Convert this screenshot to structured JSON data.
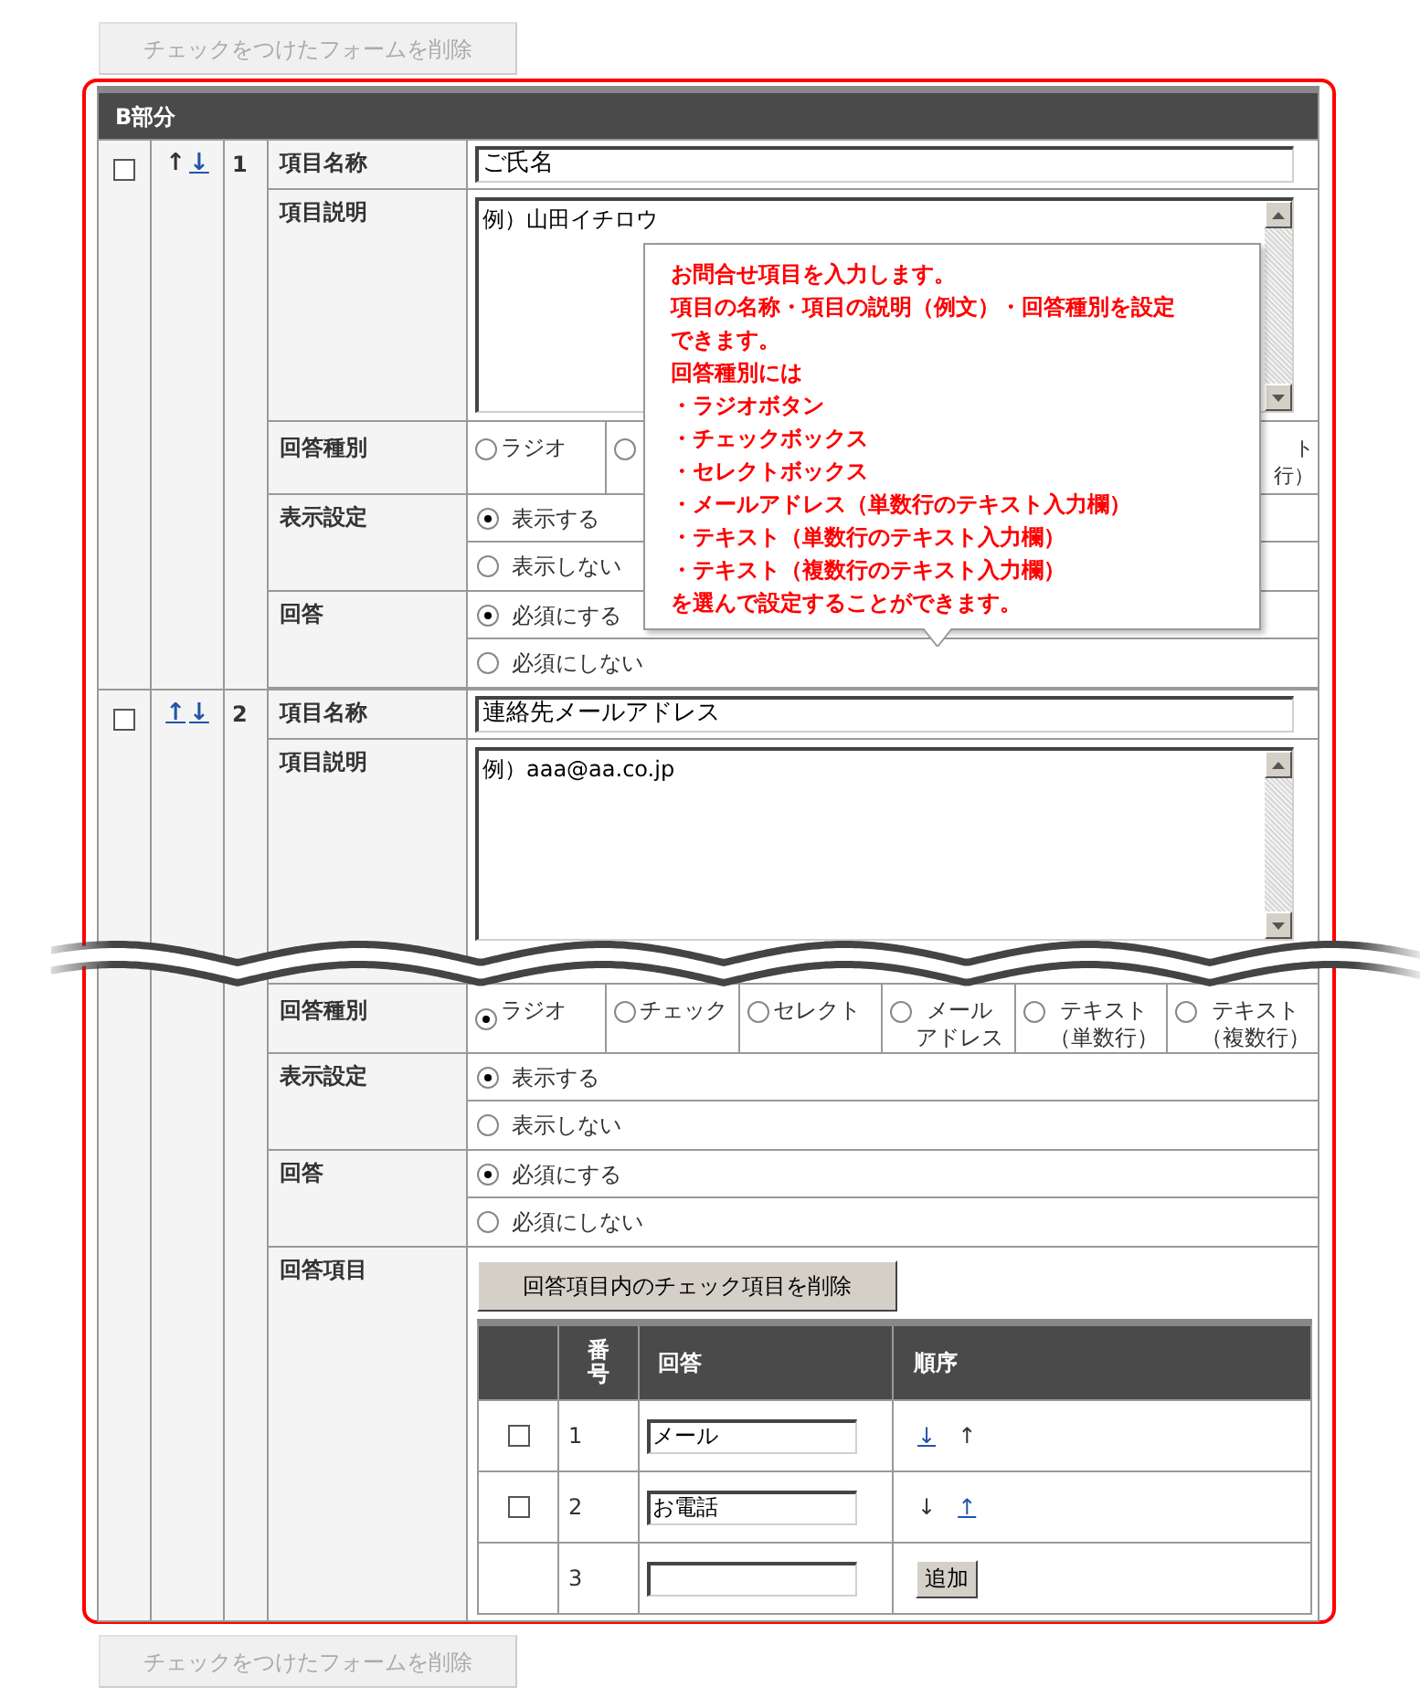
{
  "top_button": {
    "label": "チェックをつけたフォームを削除",
    "disabled": true
  },
  "section": {
    "title": "B部分",
    "items": [
      {
        "checked": false,
        "move_up": {
          "label": "↑",
          "link": false
        },
        "move_down": {
          "label": "↓",
          "link": true
        },
        "number": "1",
        "name": {
          "label": "項目名称",
          "value": "ご氏名"
        },
        "description": {
          "label": "項目説明",
          "value": "例）山田イチロウ"
        },
        "answer_type": {
          "label": "回答種別",
          "options": [
            {
              "label": "ラジオ",
              "selected": false
            },
            {
              "selected": false
            }
          ],
          "fragment": {
            "line_1": "ト",
            "line_2": "行）"
          }
        },
        "display": {
          "label": "表示設定",
          "options": [
            {
              "label": "表示する",
              "selected": true
            },
            {
              "label": "表示しない",
              "selected": false
            }
          ]
        },
        "required": {
          "label": "回答",
          "options": [
            {
              "label": "必須にする",
              "selected": true
            },
            {
              "label": "必須にしない",
              "selected": false
            }
          ]
        }
      },
      {
        "checked": false,
        "move_up": {
          "label": "↑",
          "link": true
        },
        "move_down": {
          "label": "↓",
          "link": true
        },
        "number": "2",
        "name": {
          "label": "項目名称",
          "value": "連絡先メールアドレス"
        },
        "description": {
          "label": "項目説明",
          "value": "例）aaa@aa.co.jp"
        },
        "answer_type": {
          "label": "回答種別",
          "options": [
            {
              "label": "ラジオ",
              "selected": true
            },
            {
              "label": "チェック",
              "selected": false
            },
            {
              "label": "セレクト",
              "selected": false
            },
            {
              "label": "メール",
              "label_2": "アドレス",
              "selected": false
            },
            {
              "label": "テキスト",
              "label_2": "（単数行）",
              "selected": false
            },
            {
              "label": "テキスト",
              "label_2": "（複数行）",
              "selected": false
            }
          ]
        },
        "display": {
          "label": "表示設定",
          "options": [
            {
              "label": "表示する",
              "selected": true
            },
            {
              "label": "表示しない",
              "selected": false
            }
          ]
        },
        "required": {
          "label": "回答",
          "options": [
            {
              "label": "必須にする",
              "selected": true
            },
            {
              "label": "必須にしない",
              "selected": false
            }
          ]
        },
        "answer_items": {
          "label": "回答項目",
          "delete_button": "回答項目内のチェック項目を削除",
          "columns": [
            "番号",
            "回答",
            "順序"
          ],
          "rows": [
            {
              "kind": "item",
              "checked": false,
              "number": "1",
              "value": "メール",
              "down": {
                "label": "↓",
                "link": true
              },
              "up": {
                "label": "↑",
                "link": false
              }
            },
            {
              "kind": "item",
              "checked": false,
              "number": "2",
              "value": "お電話",
              "down": {
                "label": "↓",
                "link": false
              },
              "up": {
                "label": "↑",
                "link": true
              }
            },
            {
              "kind": "new",
              "number": "3",
              "add_button": "追加"
            }
          ]
        }
      }
    ]
  },
  "tooltip": {
    "lines": [
      "お問合せ項目を入力します。",
      "項目の名称・項目の説明（例文）・回答種別を設定",
      "できます。",
      "回答種別には",
      "・ラジオボタン",
      "・チェックボックス",
      "・セレクトボックス",
      "・メールアドレス（単数行のテキスト入力欄）",
      "・テキスト（単数行のテキスト入力欄）",
      "・テキスト（複数行のテキスト入力欄）",
      "を選んで設定することができます。"
    ]
  },
  "bottom_button": {
    "label": "チェックをつけたフォームを削除",
    "disabled": true
  }
}
